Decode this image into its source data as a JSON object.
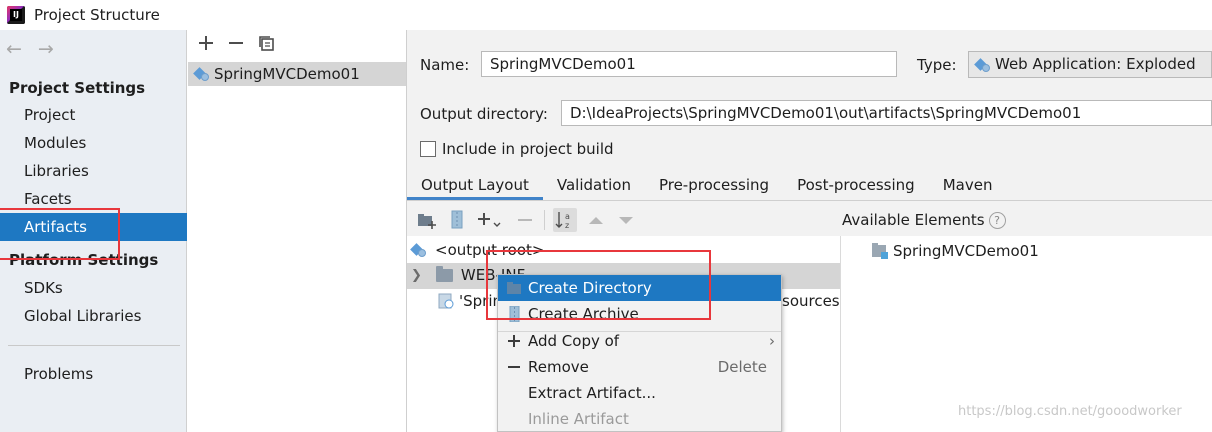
{
  "window": {
    "title": "Project Structure"
  },
  "sidebar": {
    "nav_back": "←",
    "nav_forward": "→",
    "project_settings_heading": "Project Settings",
    "project_items": [
      "Project",
      "Modules",
      "Libraries",
      "Facets",
      "Artifacts"
    ],
    "platform_settings_heading": "Platform Settings",
    "platform_items": [
      "SDKs",
      "Global Libraries"
    ],
    "problems": "Problems",
    "selected": "Artifacts"
  },
  "artifact_list": {
    "toolbar": [
      "add-icon",
      "remove-icon",
      "copy-icon"
    ],
    "items": [
      "SpringMVCDemo01"
    ]
  },
  "form": {
    "name_label": "Name:",
    "name_value": "SpringMVCDemo01",
    "type_label": "Type:",
    "type_value": "Web Application: Exploded",
    "output_dir_label": "Output directory:",
    "output_dir_value": "D:\\IdeaProjects\\SpringMVCDemo01\\out\\artifacts\\SpringMVCDemo01",
    "include_label": "Include in project build",
    "include_checked": false
  },
  "tabs": [
    "Output Layout",
    "Validation",
    "Pre-processing",
    "Post-processing",
    "Maven"
  ],
  "active_tab": "Output Layout",
  "layout": {
    "available_elements_label": "Available Elements",
    "tree": [
      {
        "label": "<output root>"
      },
      {
        "label": "WEB-INF"
      },
      {
        "label": "'Sprin"
      },
      {
        "label": "sources"
      }
    ],
    "available": [
      "SpringMVCDemo01"
    ]
  },
  "context_menu": {
    "items": [
      {
        "label": "Create Directory",
        "highlighted": true
      },
      {
        "label": "Create Archive"
      },
      {
        "label": "Add Copy of",
        "submenu": true
      },
      {
        "label": "Remove",
        "shortcut": "Delete"
      },
      {
        "label": "Extract Artifact..."
      },
      {
        "label": "Inline Artifact",
        "disabled": true
      }
    ]
  },
  "watermark": "https://blog.csdn.net/gooodworker",
  "colors": {
    "selection": "#1e78c2",
    "annotation_red": "#e8373c",
    "tab_underline": "#4083c9"
  }
}
